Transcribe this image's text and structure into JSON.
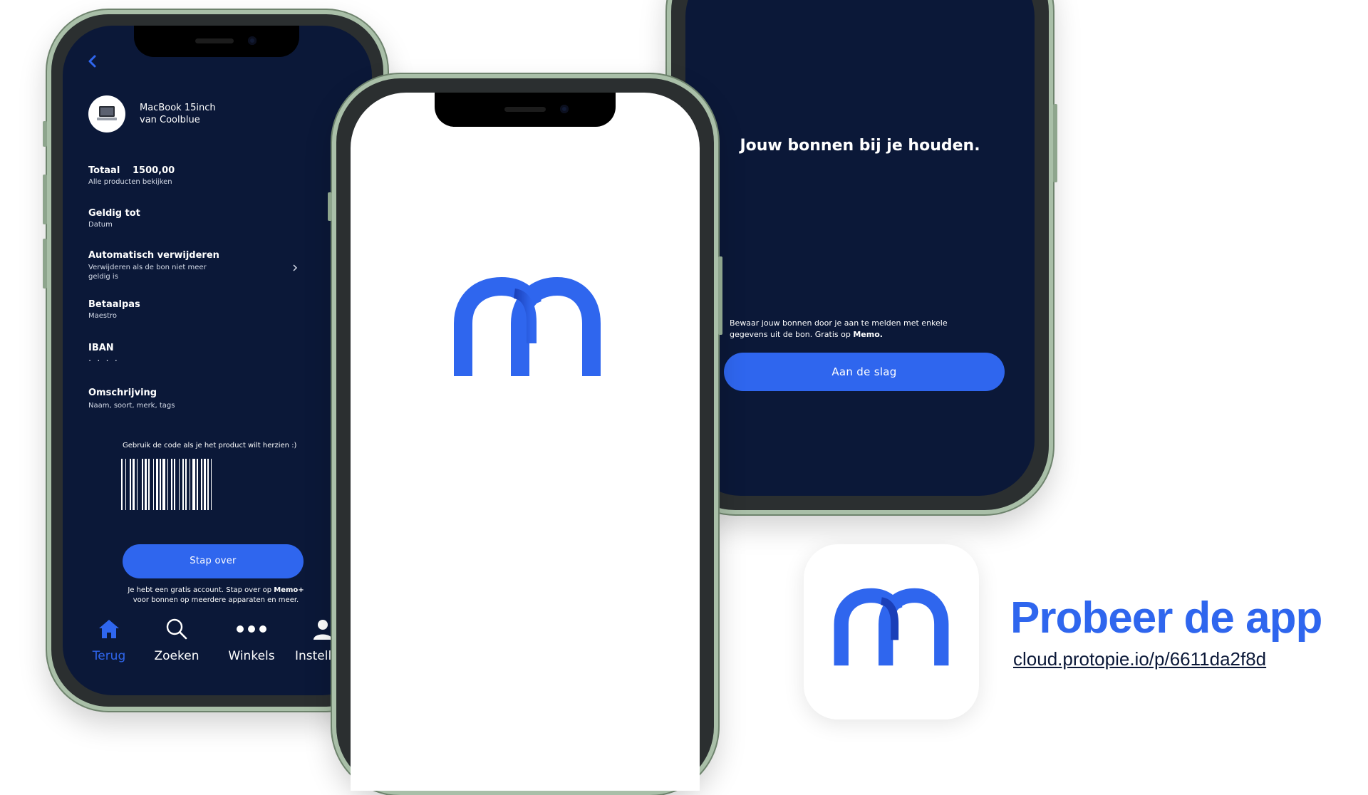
{
  "left_phone": {
    "product_name_line1": "MacBook 15inch",
    "product_name_line2": "van Coolblue",
    "total_label": "Totaal",
    "total_value": "1500,00",
    "total_sub": "Alle producten bekijken",
    "valid_label": "Geldig tot",
    "valid_sub": "Datum",
    "auto_delete_label": "Automatisch verwijderen",
    "auto_delete_sub_1": "Verwijderen als de bon niet meer",
    "auto_delete_sub_2": "geldig is",
    "card_label": "Betaalpas",
    "card_sub": "Maestro",
    "iban_label": "IBAN",
    "iban_value": "· · · ·",
    "desc_label": "Omschrijving",
    "desc_sub": "Naam, soort, merk, tags",
    "barcode_caption": "Gebruik de code als je het product wilt herzien :)",
    "switch_button": "Stap over",
    "switch_note_1": "Je hebt een gratis account. Stap over op",
    "switch_note_brand": "Memo+",
    "switch_note_2": "voor bonnen op meerdere apparaten en meer.",
    "nav": [
      {
        "label": "Terug",
        "icon": "home-icon",
        "active": true
      },
      {
        "label": "Zoeken",
        "icon": "search-icon",
        "active": false
      },
      {
        "label": "Winkels",
        "icon": "more-dots-icon",
        "active": false
      },
      {
        "label": "Instelli",
        "icon": "user-icon",
        "active": false
      }
    ]
  },
  "right_phone": {
    "headline": "Jouw bonnen bij je houden.",
    "body_1": "Bewaar jouw bonnen door je aan te melden met enkele",
    "body_2": "gegevens uit de bon. Gratis op",
    "body_brand": "Memo.",
    "cta": "Aan de slag"
  },
  "promo": {
    "title": "Probeer de app",
    "link": "cloud.protopie.io/p/6611da2f8d"
  },
  "colors": {
    "accent": "#2f66ee",
    "dark_bg": "#0b1838",
    "frame": "#a9bfa8"
  }
}
